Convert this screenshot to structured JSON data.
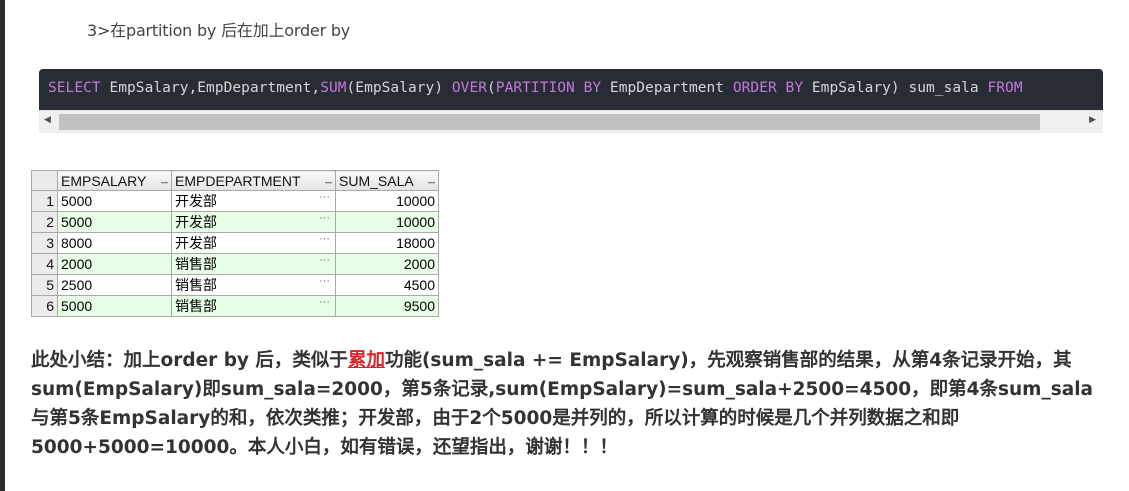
{
  "heading": "3>在partition by 后在加上order by",
  "code": {
    "tokens": [
      {
        "text": "SELECT",
        "kw": true
      },
      {
        "text": " EmpSalary,EmpDepartment,",
        "kw": false
      },
      {
        "text": "SUM",
        "kw": true
      },
      {
        "text": "(EmpSalary) ",
        "kw": false
      },
      {
        "text": "OVER",
        "kw": true
      },
      {
        "text": "(",
        "kw": false
      },
      {
        "text": "PARTITION BY",
        "kw": true
      },
      {
        "text": " EmpDepartment ",
        "kw": false
      },
      {
        "text": "ORDER BY",
        "kw": true
      },
      {
        "text": " EmpSalary) sum_sala ",
        "kw": false
      },
      {
        "text": "FROM",
        "kw": true
      }
    ]
  },
  "colors": {
    "code_bg": "#282c34",
    "keyword": "#c678dd",
    "even_row": "#e6ffe6",
    "link": "#e0202a"
  },
  "grid": {
    "columns": [
      "EMPSALARY",
      "EMPDEPARTMENT",
      "SUM_SALA"
    ],
    "rows": [
      {
        "n": "1",
        "salary": "5000",
        "dept": "开发部",
        "sum": "10000"
      },
      {
        "n": "2",
        "salary": "5000",
        "dept": "开发部",
        "sum": "10000"
      },
      {
        "n": "3",
        "salary": "8000",
        "dept": "开发部",
        "sum": "18000"
      },
      {
        "n": "4",
        "salary": "2000",
        "dept": "销售部",
        "sum": "2000"
      },
      {
        "n": "5",
        "salary": "2500",
        "dept": "销售部",
        "sum": "4500"
      },
      {
        "n": "6",
        "salary": "5000",
        "dept": "销售部",
        "sum": "9500"
      }
    ],
    "ellipsis": "···"
  },
  "summary": {
    "before_link": "此处小结：加上order by 后，类似于",
    "link": "累加",
    "after_link": "功能(sum_sala += EmpSalary)，先观察销售部的结果，从第4条记录开始，其sum(EmpSalary)即sum_sala=2000，第5条记录,sum(EmpSalary)=sum_sala+2500=4500，即第4条sum_sala与第5条EmpSalary的和，依次类推；开发部，由于2个5000是并列的，所以计算的时候是几个并列数据之和即5000+5000=10000。本人小白，如有错误，还望指出，谢谢！！！"
  }
}
